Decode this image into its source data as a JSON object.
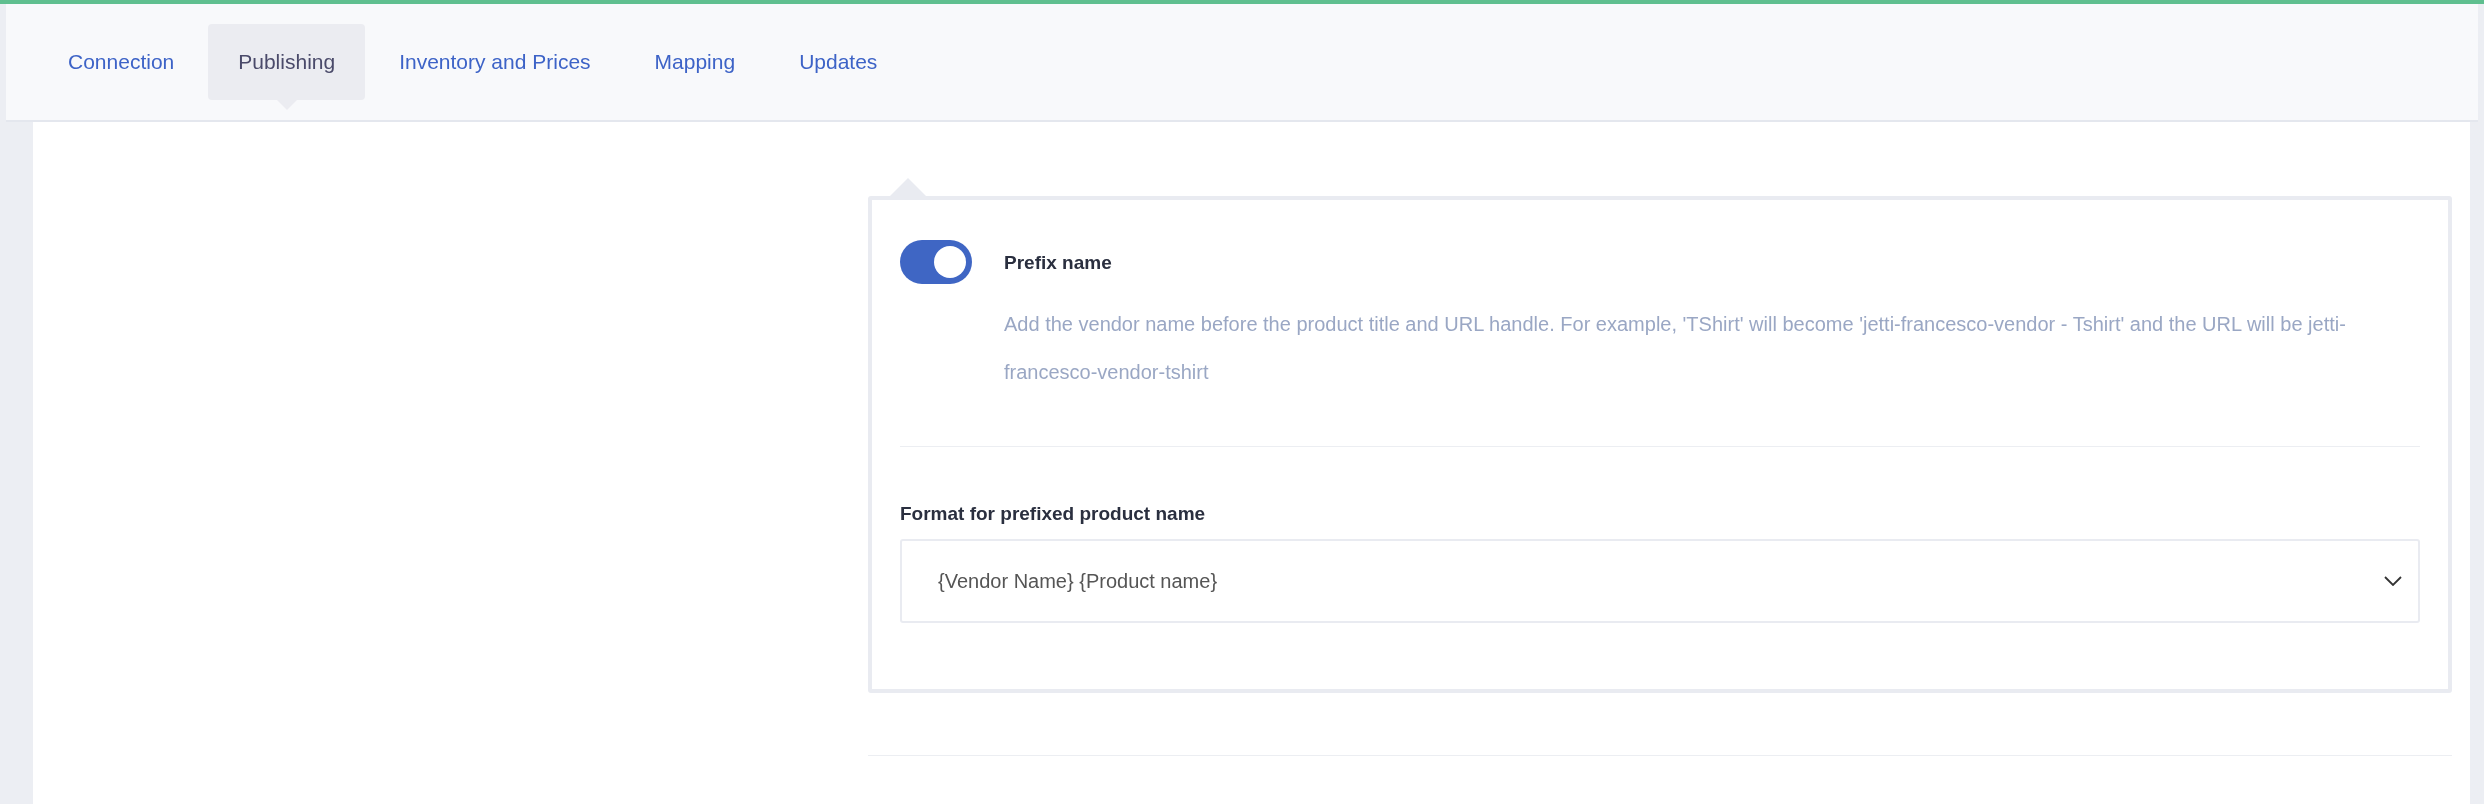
{
  "tabs": [
    {
      "label": "Connection",
      "selected": false
    },
    {
      "label": "Publishing",
      "selected": true
    },
    {
      "label": "Inventory and Prices",
      "selected": false
    },
    {
      "label": "Mapping",
      "selected": false
    },
    {
      "label": "Updates",
      "selected": false
    }
  ],
  "prefix_setting": {
    "title": "Prefix name",
    "on": true,
    "description": "Add the vendor name before the product title and URL handle. For example, 'TShirt' will become 'jetti-francesco-vendor - Tshirt' and the URL will be jetti-francesco-vendor-tshirt"
  },
  "format_field": {
    "label": "Format for prefixed product name",
    "value": "{Vendor Name} {Product name}"
  }
}
